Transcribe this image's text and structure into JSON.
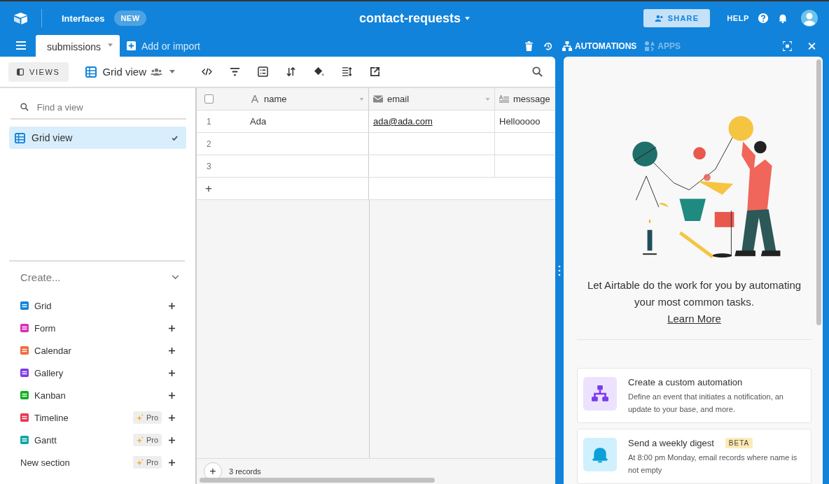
{
  "topbar": {
    "interfaces": "Interfaces",
    "new_badge": "NEW",
    "title": "contact-requests",
    "share": "SHARE",
    "help": "HELP"
  },
  "tabbar": {
    "tabs": [
      {
        "label": "submissions",
        "selected": true
      }
    ],
    "add": "Add or import",
    "panel_tabs": [
      {
        "label": "AUTOMATIONS",
        "selected": true
      },
      {
        "label": "APPS",
        "selected": false
      }
    ]
  },
  "toolbar": {
    "views": "VIEWS",
    "view_name": "Grid view"
  },
  "sidebar": {
    "search": {
      "placeholder": "Find a view"
    },
    "views": [
      {
        "label": "Grid view",
        "selected": true
      }
    ],
    "create": {
      "title": "Create...",
      "expanded": true,
      "items": [
        {
          "kind": "view",
          "label": "Grid",
          "color": "#1283da"
        },
        {
          "kind": "view",
          "label": "Form",
          "color": "#dd2fb3"
        },
        {
          "kind": "view",
          "label": "Calendar",
          "color": "#f06a3a"
        },
        {
          "kind": "view",
          "label": "Gallery",
          "color": "#7c39ed"
        },
        {
          "kind": "view",
          "label": "Kanban",
          "color": "#11af22"
        },
        {
          "kind": "view",
          "label": "Timeline",
          "color": "#e8384f",
          "badge": "Pro"
        },
        {
          "kind": "view",
          "label": "Gantt",
          "color": "#0ea5a5",
          "badge": "Pro"
        },
        {
          "kind": "section",
          "label": "New section",
          "badge": "Pro"
        }
      ]
    }
  },
  "table": {
    "select_all_checked": false,
    "columns": [
      {
        "label": "name",
        "kind": "text"
      },
      {
        "label": "email",
        "kind": "email"
      },
      {
        "label": "message",
        "kind": "longtext"
      }
    ],
    "rows": [
      {
        "number": "1",
        "cells": [
          "Ada",
          "ada@ada.com",
          "Hellooooo"
        ]
      },
      {
        "number": "2",
        "cells": [
          "",
          "",
          ""
        ]
      },
      {
        "number": "3",
        "cells": [
          "",
          "",
          ""
        ]
      }
    ],
    "add_row": "+",
    "footer_add": "+",
    "record_count": "3 records"
  },
  "automations": {
    "intro": "Let Airtable do the work for you by automating your most common tasks.",
    "learn_more": "Learn More",
    "cards": [
      {
        "kind": "custom",
        "title": "Create a custom automation",
        "description": "Define an event that initiates a notification, an update to your base, and more."
      },
      {
        "kind": "digest",
        "title": "Send a weekly digest",
        "badge": "BETA",
        "description": "At 8:00 pm Monday, email records where name is not empty"
      }
    ]
  }
}
